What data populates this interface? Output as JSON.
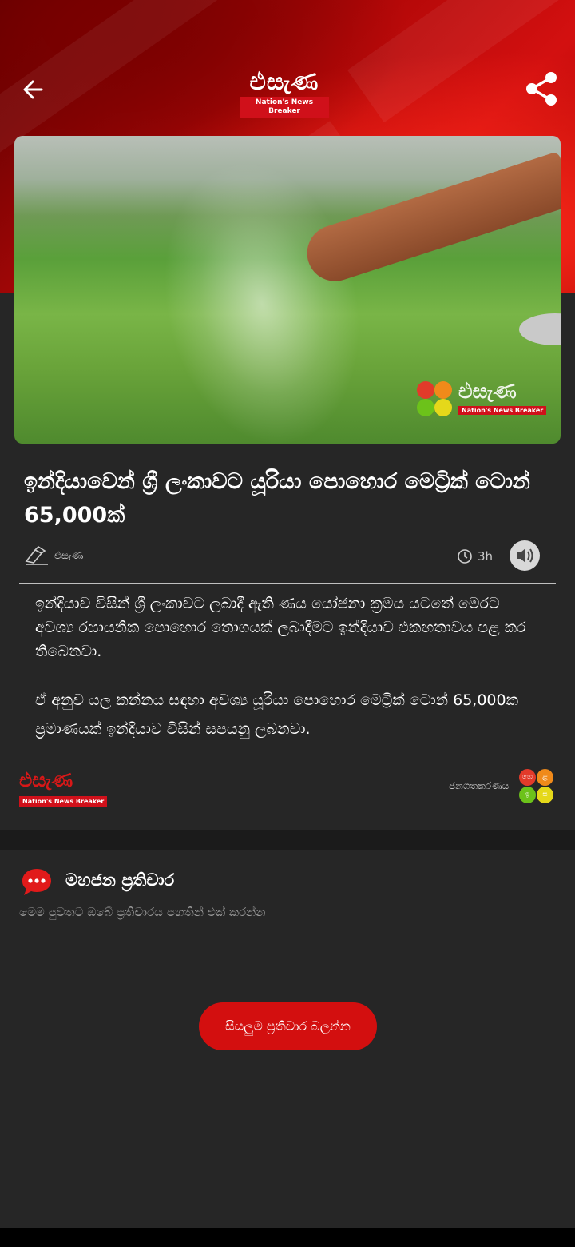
{
  "header": {
    "logo_text": "එසැණ",
    "logo_tagline": "Nation's News Breaker"
  },
  "hero": {
    "watermark_text": "එසැණ",
    "watermark_tagline": "Nation's News Breaker"
  },
  "article": {
    "title": "ඉන්දියාවෙන් ශ්‍රී ලංකාවට යූරියා පොහොර මෙට්‍රික් ටොන් 65,000ක්",
    "author": "එසැණ",
    "time": "3h",
    "paragraphs": [
      "ඉන්දියාව විසින් ශ්‍රී ලංකාවට ලබාදී ඇති ණය යෝජනා ක්‍රමය යටතේ මෙරට අවශ්‍ය රසායනික පොහොර තොගයක් ලබාදීමට ඉන්දියාව එකඟතාවය පළ කර තිබෙනවා.",
      "ඒ අනුව යල කන්නය සඳහා අවශ්‍ය යූරියා පොහොර මෙට්‍රික් ටොන් 65,000ක ප්‍රමාණයක් ඉන්දියාව විසින් සපයනු ලබනවා."
    ]
  },
  "footer": {
    "logo_text": "එසැණ",
    "logo_tagline": "Nation's News Breaker",
    "publisher_label": "ජනගතකරණය",
    "publisher_dots": [
      "හෙ",
      "ළ",
      "ඉ",
      "ස"
    ]
  },
  "comments": {
    "title": "මහජන ප්‍රතිචාර",
    "subtitle": "මෙම පුවතට ඔබේ ප්‍රතිචාරය පහතින් එක් කරන්න",
    "view_all_label": "සියලුම ප්‍රතිචාර බලන්න"
  },
  "colors": {
    "brand_red": "#d30f0f",
    "background": "#262626"
  }
}
